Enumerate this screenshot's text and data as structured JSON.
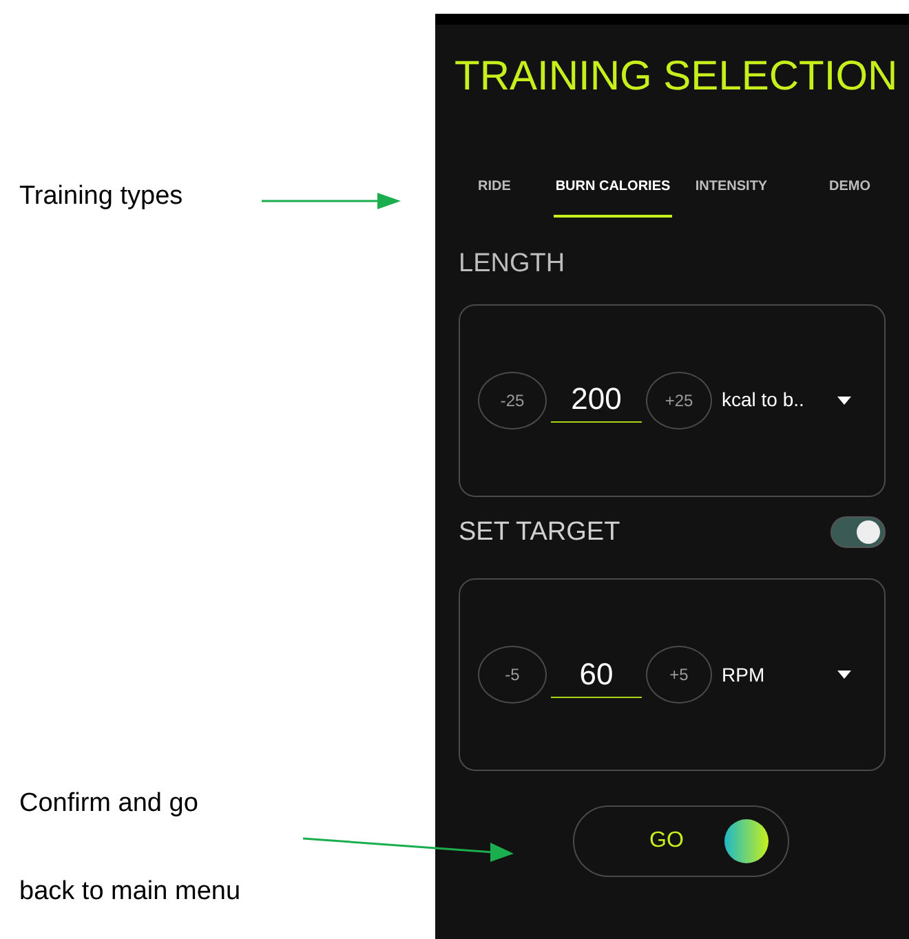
{
  "annotations": [
    {
      "text": "Training types"
    },
    {
      "text": "Confirm and go"
    },
    {
      "text": "back to main menu"
    }
  ],
  "screen": {
    "title": "TRAINING SELECTION",
    "tabs": [
      {
        "label": "RIDE",
        "selected": false
      },
      {
        "label": "BURN CALORIES",
        "selected": true
      },
      {
        "label": "INTENSITY",
        "selected": false
      },
      {
        "label": "DEMO",
        "selected": false
      }
    ],
    "length": {
      "label": "LENGTH",
      "minus": "-25",
      "value": "200",
      "plus": "+25",
      "unit": "kcal to b.."
    },
    "target": {
      "label": "SET TARGET",
      "on": true,
      "minus": "-5",
      "value": "60",
      "plus": "+5",
      "unit": "RPM"
    },
    "go_button": {
      "label": "GO"
    }
  }
}
